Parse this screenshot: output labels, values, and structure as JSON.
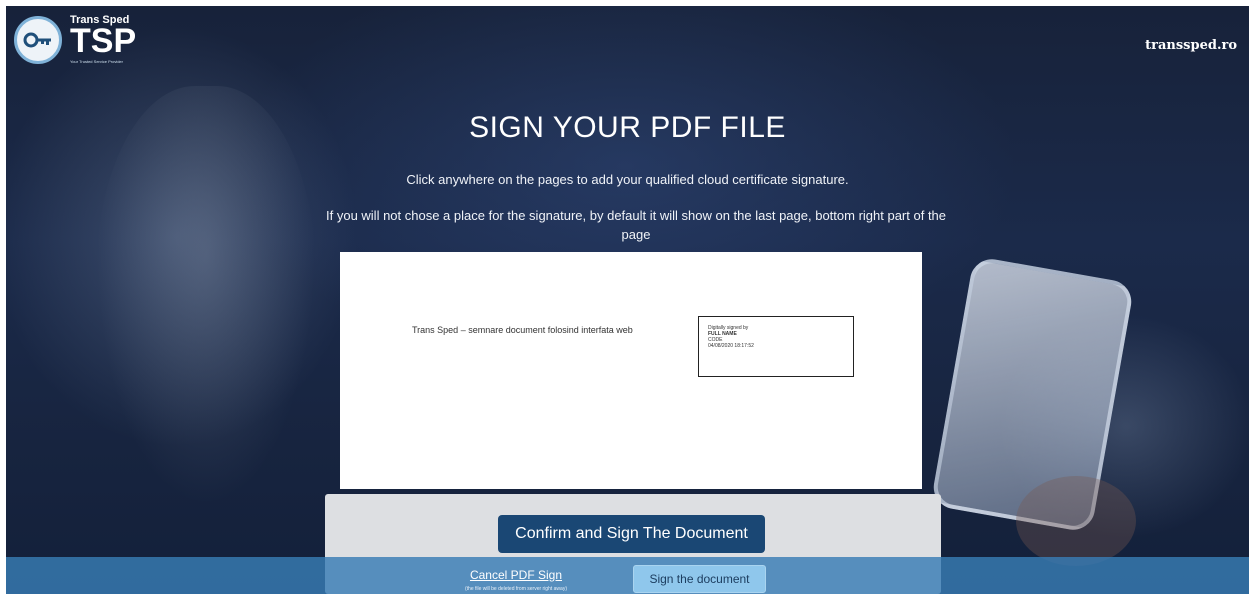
{
  "brand": {
    "small_text": "Trans Sped",
    "big_text": "TSP",
    "tagline": "Your Trusted Service Provider"
  },
  "header": {
    "site_link": "transsped.ro"
  },
  "main": {
    "title": "SIGN YOUR PDF FILE",
    "instruction_1": "Click anywhere on the pages to add your qualified cloud certificate signature.",
    "instruction_2": "If you will not chose a place for the signature, by default it will show on the last page, bottom right part of the page"
  },
  "pdf_preview": {
    "document_text": "Trans Sped – semnare document folosind interfata web",
    "signature": {
      "line1": "Digitally signed by",
      "line2": "FULL NAME",
      "line3": "CODE",
      "line4": "04/08/2020 18:17:52"
    }
  },
  "actions": {
    "confirm_label": "Confirm and Sign The Document",
    "cancel_label": "Cancel PDF Sign",
    "cancel_note": "(the file will be deleted from server right away)",
    "sign_label": "Sign the document"
  },
  "colors": {
    "confirm_button": "#1a4774",
    "footer_bar": "#387db4",
    "sign_button": "#8fc7ec"
  }
}
